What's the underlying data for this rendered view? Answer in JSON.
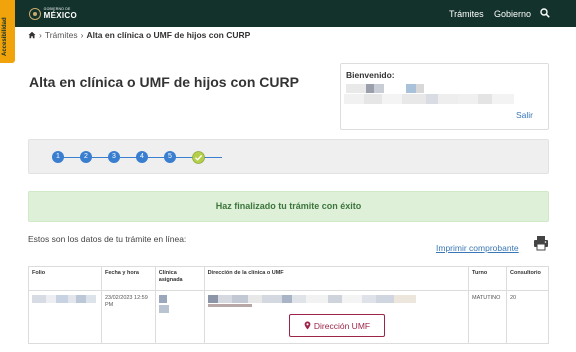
{
  "header": {
    "logo_small": "GOBIERNO DE",
    "logo_big": "MÉXICO",
    "nav_tramites": "Trámites",
    "nav_gobierno": "Gobierno",
    "search_icon": "search-icon"
  },
  "accessibility_tab": "Accesibilidad",
  "breadcrumb": {
    "separator": "›",
    "link": "Trámites",
    "current": "Alta en clínica o UMF de hijos con CURP"
  },
  "page_title": "Alta en clínica o UMF de hijos con CURP",
  "welcome": {
    "label": "Bienvenido:",
    "logout": "Salir"
  },
  "stepper": {
    "steps": [
      "1",
      "2",
      "3",
      "4",
      "5"
    ],
    "done_icon": "check-circle-icon"
  },
  "alert": "Haz finalizado tu trámite con éxito",
  "intro": "Estos son los datos de tu trámite en línea:",
  "print_link": "Imprimir comprobante",
  "table": {
    "headers": [
      "Folio",
      "Fecha y hora",
      "Clínica asignada",
      "Dirección de la clínica o UMF",
      "Turno",
      "Consultorio"
    ],
    "row": {
      "fecha": "23/02/2023 12:59 PM",
      "turno": "MATUTINO",
      "consultorio": "20"
    }
  },
  "umf_button": "Dirección UMF",
  "colors": {
    "header_bg": "#13322b",
    "accent_gold": "#f0a30a",
    "link_blue": "#3a77b7",
    "step_blue": "#3a7ecf",
    "success_bg": "#dff0d8",
    "success_text": "#3c763d",
    "button_red": "#9d2449"
  }
}
